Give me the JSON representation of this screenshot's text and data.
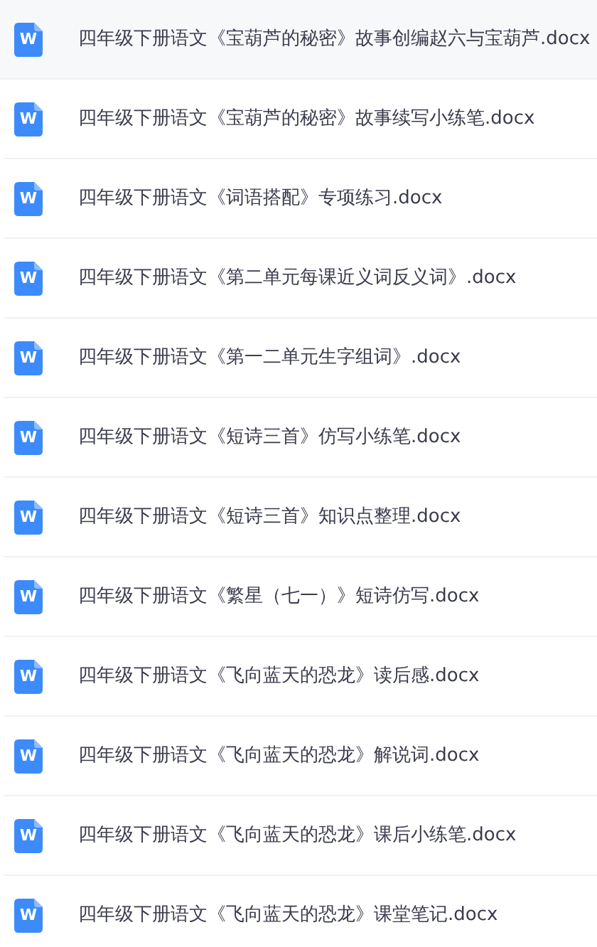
{
  "files": [
    {
      "name": "四年级下册语文《宝葫芦的秘密》故事创编赵六与宝葫芦.docx",
      "icon_text": "W",
      "selected": true
    },
    {
      "name": "四年级下册语文《宝葫芦的秘密》故事续写小练笔.docx",
      "icon_text": "W",
      "selected": false
    },
    {
      "name": "四年级下册语文《词语搭配》专项练习.docx",
      "icon_text": "W",
      "selected": false
    },
    {
      "name": "四年级下册语文《第二单元每课近义词反义词》.docx",
      "icon_text": "W",
      "selected": false
    },
    {
      "name": "四年级下册语文《第一二单元生字组词》.docx",
      "icon_text": "W",
      "selected": false
    },
    {
      "name": "四年级下册语文《短诗三首》仿写小练笔.docx",
      "icon_text": "W",
      "selected": false
    },
    {
      "name": "四年级下册语文《短诗三首》知识点整理.docx",
      "icon_text": "W",
      "selected": false
    },
    {
      "name": "四年级下册语文《繁星（七一）》短诗仿写.docx",
      "icon_text": "W",
      "selected": false
    },
    {
      "name": "四年级下册语文《飞向蓝天的恐龙》读后感.docx",
      "icon_text": "W",
      "selected": false
    },
    {
      "name": "四年级下册语文《飞向蓝天的恐龙》解说词.docx",
      "icon_text": "W",
      "selected": false
    },
    {
      "name": "四年级下册语文《飞向蓝天的恐龙》课后小练笔.docx",
      "icon_text": "W",
      "selected": false
    },
    {
      "name": "四年级下册语文《飞向蓝天的恐龙》课堂笔记.docx",
      "icon_text": "W",
      "selected": false
    }
  ]
}
